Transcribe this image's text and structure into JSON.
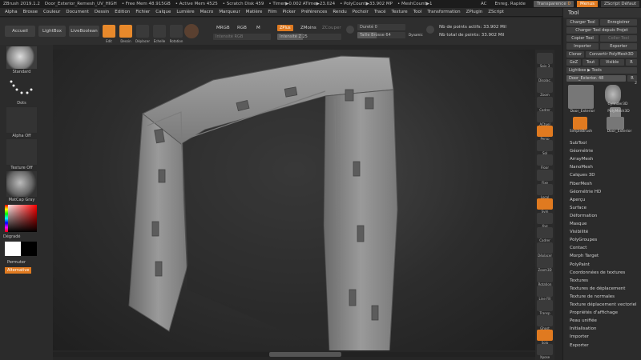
{
  "titlebar": {
    "app": "ZBrush 2019.1.2",
    "doc": "Door_Exterior_Remesh_UV_HIGH",
    "free_mem": "• Free Mem 48.915GB",
    "active_mem": "• Active Mem 4525",
    "scratch": "• Scratch Disk 459",
    "timer": "• Timer▶0.002 ATime▶23.024",
    "polycount": "• PolyCount▶33.902 MP",
    "meshcount": "• MeshCount▶1",
    "ac": "AC",
    "quick_save": "Enreg. Rapide",
    "transparency_label": "Transparence",
    "transparency_value": "0",
    "menus_btn": "Menus",
    "zscript_default": "ZScript Défaut"
  },
  "menubar": [
    "Alpha",
    "Brosse",
    "Couleur",
    "Document",
    "Dessin",
    "Edition",
    "Fichier",
    "Calque",
    "Lumière",
    "Macro",
    "Marqueur",
    "Matière",
    "Film",
    "Picker",
    "Préférences",
    "Rendu",
    "Pochoir",
    "Tracé",
    "Texture",
    "Tool",
    "Transformation",
    "ZPlugin",
    "ZScript"
  ],
  "shelf": {
    "accueil": "Accueil",
    "lightbox": "LightBox",
    "liveboolean": "LiveBoolean",
    "tools": [
      "Edit",
      "Dessin",
      "Déplacer",
      "Echelle",
      "Rotation"
    ],
    "mrgb": "MRGB",
    "rgb": "RGB",
    "m": "M",
    "intensity_rgb": "Intensité RGB",
    "zadd": "ZPlus",
    "zsub": "ZMoins",
    "zcut": "ZCouper",
    "z_intensity": "Intensité Z 25",
    "durete": "Dureté 0",
    "brush_size": "Taille Brosse 64",
    "dynamic": "Dynamic",
    "points_actifs": "Nb de points actifs: 33.902 Mil",
    "points_total": "Nb total de points: 33.902 Mil"
  },
  "lefttray": {
    "standard": "Standard",
    "dots": "Dots",
    "alpha_off": "Alpha Off",
    "texture_off": "Texture Off",
    "matcap": "MatCap Gray",
    "degrade": "Dégradé",
    "permuter": "Permuter",
    "alternative": "Alternative"
  },
  "rightshelf": [
    "Spix 3",
    "Displac.",
    "Zoom",
    "Cadrer",
    "ACtuel",
    "Persp",
    "Sol",
    "Floor",
    "Fixe",
    "Local",
    "Sym",
    "Xyz",
    "Cadrer",
    "Déplacer",
    "Zoom3D",
    "Rotation",
    "Line Fill",
    "Transp",
    "Ghost",
    "Solo",
    "Xpose"
  ],
  "toolpalette": {
    "title": "Tool",
    "load_tool": "Charger Tool",
    "save": "Enregistrer",
    "load_from_project": "Charger Tool depuis Projet",
    "copy_tool": "Copier Tool",
    "paste_tool": "Coller Tool",
    "import": "Importer",
    "export": "Exporter",
    "clone": "Cloner",
    "convert": "Convertir PolyMesh3D",
    "goz": "GoZ",
    "all": "Tout",
    "visible": "Visible",
    "r": "R",
    "lightbox_tools": "Lightbox ▶ Tools",
    "current_tool": "Door_Exterior.",
    "current_tool_value": "48",
    "thumbs": [
      "Door_Exterior",
      "Cylinder3D",
      "PolyMesh3D",
      "SimpleBrush",
      "Door_Exterior"
    ],
    "thumb_count": "2",
    "items": [
      "SubTool",
      "Géométrie",
      "ArrayMesh",
      "NanoMesh",
      "Calques 3D",
      "FiberMesh",
      "Géométrie HD",
      "Aperçu",
      "Surface",
      "Déformation",
      "Masque",
      "Visibilité",
      "PolyGroupes",
      "Contact",
      "Morph Target",
      "PolyPaint",
      "Coordonnées de textures",
      "Textures",
      "Textures de déplacement",
      "Texture de normales",
      "Texture déplacement vectoriel",
      "Propriétés d'affichage",
      "Peau unifiée",
      "Initialisation",
      "Importer",
      "Exporter"
    ]
  },
  "colors": {
    "accent": "#e07a20",
    "viewport_bg": "#1b1b1b",
    "panel": "#2b2b2b"
  }
}
